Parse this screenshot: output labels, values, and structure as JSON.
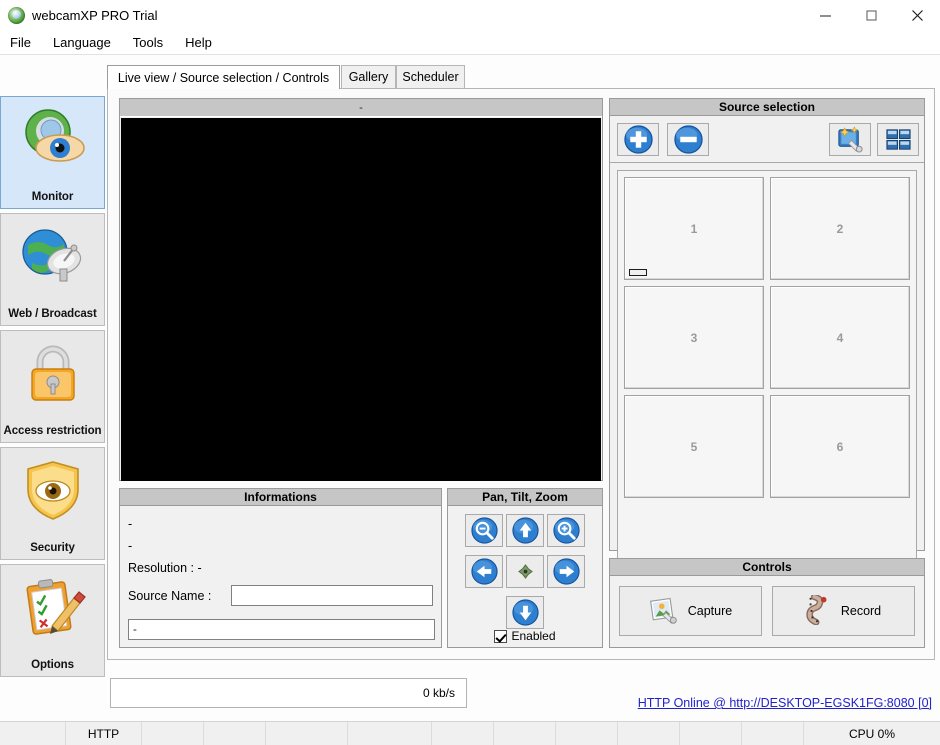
{
  "window": {
    "title": "webcamXP PRO Trial",
    "app_icon": "webcamxp-logo-icon",
    "minimize_label": "—",
    "maximize_label": "□",
    "close_label": "✕"
  },
  "menu": {
    "items": [
      {
        "label": "File"
      },
      {
        "label": "Language"
      },
      {
        "label": "Tools"
      },
      {
        "label": "Help"
      }
    ]
  },
  "sidebar": {
    "items": [
      {
        "label": "Monitor",
        "icon": "monitor-eye-icon",
        "selected": true
      },
      {
        "label": "Web / Broadcast",
        "icon": "globe-satellite-icon",
        "selected": false
      },
      {
        "label": "Access restriction",
        "icon": "padlock-icon",
        "selected": false
      },
      {
        "label": "Security",
        "icon": "shield-eye-icon",
        "selected": false
      },
      {
        "label": "Options",
        "icon": "clipboard-pencil-icon",
        "selected": false
      }
    ]
  },
  "tabs": [
    {
      "label": "Live view / Source selection / Controls",
      "active": true
    },
    {
      "label": "Gallery",
      "active": false
    },
    {
      "label": "Scheduler",
      "active": false
    }
  ],
  "video": {
    "header_title": "-"
  },
  "informations": {
    "title": "Informations",
    "line1": "-",
    "line2": "-",
    "resolution": "Resolution : -",
    "source_name_label": "Source Name :",
    "source_name_value": "",
    "source_name_placeholder": "",
    "status_value": "-"
  },
  "ptz": {
    "title": "Pan, Tilt, Zoom",
    "buttons": [
      {
        "name": "zoom-out",
        "icon": "magnifier-minus-icon"
      },
      {
        "name": "tilt-up",
        "icon": "arrow-up-icon"
      },
      {
        "name": "zoom-in",
        "icon": "magnifier-plus-icon"
      },
      {
        "name": "pan-left",
        "icon": "arrow-left-icon"
      },
      {
        "name": "center",
        "icon": "center-diamond-icon"
      },
      {
        "name": "pan-right",
        "icon": "arrow-right-icon"
      },
      {
        "name": "tilt-down",
        "icon": "arrow-down-icon"
      }
    ],
    "enabled_label": "Enabled",
    "enabled_checked": true
  },
  "source_selection": {
    "title": "Source selection",
    "toolbar": [
      {
        "name": "add-source",
        "icon": "plus-circle-icon"
      },
      {
        "name": "remove-source",
        "icon": "minus-circle-icon"
      },
      {
        "name": "source-wizard",
        "icon": "wizard-icon"
      },
      {
        "name": "grid-layout",
        "icon": "grid-2x2-icon"
      }
    ],
    "cells": [
      {
        "label": "1",
        "active": true
      },
      {
        "label": "2",
        "active": false
      },
      {
        "label": "3",
        "active": false
      },
      {
        "label": "4",
        "active": false
      },
      {
        "label": "5",
        "active": false
      },
      {
        "label": "6",
        "active": false
      }
    ]
  },
  "controls": {
    "title": "Controls",
    "capture_label": "Capture",
    "capture_icon": "photo-capture-icon",
    "record_label": "Record",
    "record_icon": "film-strip-icon"
  },
  "bottom": {
    "bandwidth": "0 kb/s",
    "http_link": "HTTP Online @ http://DESKTOP-EGSK1FG:8080 [0]"
  },
  "statusbar": {
    "cells": [
      "",
      "HTTP",
      "",
      "",
      "",
      "",
      "",
      "",
      "",
      "",
      "",
      "",
      "CPU 0%"
    ]
  },
  "colors": {
    "accent_blue": "#1c6fd0",
    "selected_sidebar": "#d6e7fa",
    "group_title_bg": "#c6c6c6",
    "panel_bg": "#f1f1f1",
    "link": "#2222cc"
  }
}
